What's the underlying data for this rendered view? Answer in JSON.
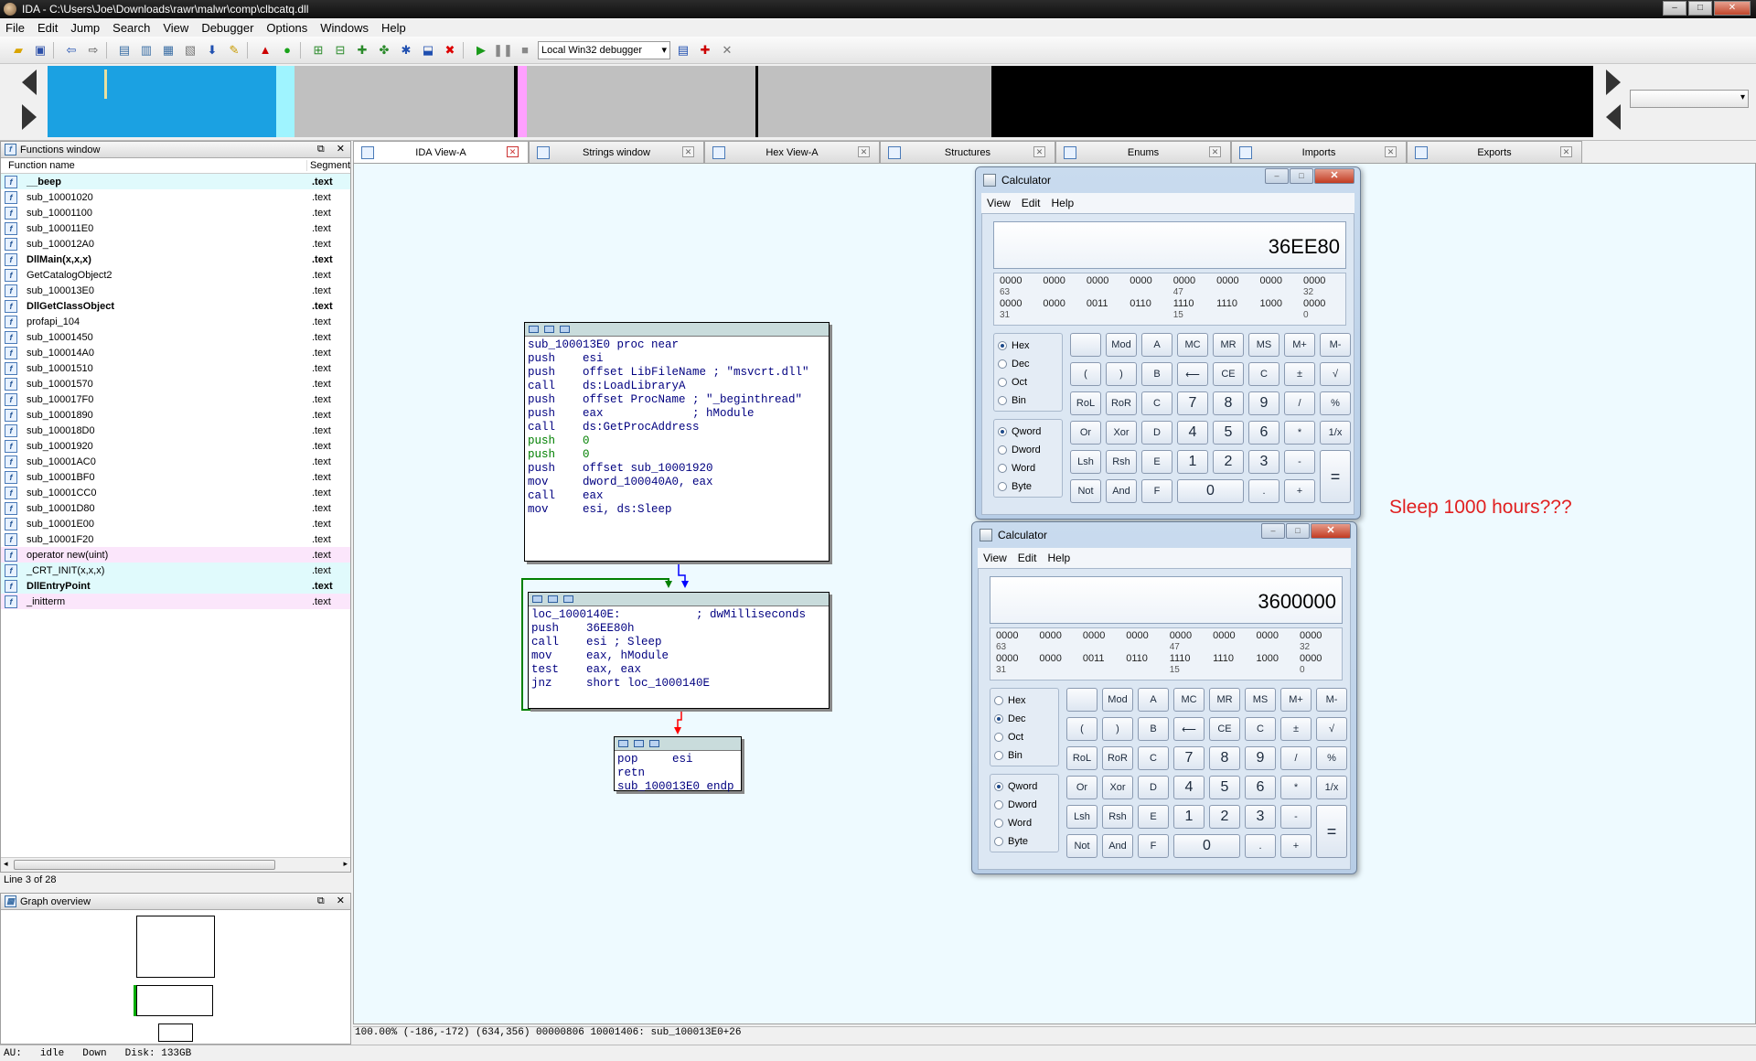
{
  "window": {
    "title": "IDA - C:\\Users\\Joe\\Downloads\\rawr\\malwr\\comp\\clbcatq.dll"
  },
  "menu": [
    "File",
    "Edit",
    "Jump",
    "Search",
    "View",
    "Debugger",
    "Options",
    "Windows",
    "Help"
  ],
  "toolbar": {
    "debugger_select": "Local Win32 debugger"
  },
  "functions_window": {
    "title": "Functions window",
    "col_name": "Function name",
    "col_segment": "Segment",
    "rows": [
      {
        "name": "__beep",
        "seg": ".text",
        "style": "bold cyan"
      },
      {
        "name": "sub_10001020",
        "seg": ".text",
        "style": ""
      },
      {
        "name": "sub_10001100",
        "seg": ".text",
        "style": ""
      },
      {
        "name": "sub_100011E0",
        "seg": ".text",
        "style": ""
      },
      {
        "name": "sub_100012A0",
        "seg": ".text",
        "style": ""
      },
      {
        "name": "DllMain(x,x,x)",
        "seg": ".text",
        "style": "bold"
      },
      {
        "name": "GetCatalogObject2",
        "seg": ".text",
        "style": ""
      },
      {
        "name": "sub_100013E0",
        "seg": ".text",
        "style": ""
      },
      {
        "name": "DllGetClassObject",
        "seg": ".text",
        "style": "bold"
      },
      {
        "name": "profapi_104",
        "seg": ".text",
        "style": ""
      },
      {
        "name": "sub_10001450",
        "seg": ".text",
        "style": ""
      },
      {
        "name": "sub_100014A0",
        "seg": ".text",
        "style": ""
      },
      {
        "name": "sub_10001510",
        "seg": ".text",
        "style": ""
      },
      {
        "name": "sub_10001570",
        "seg": ".text",
        "style": ""
      },
      {
        "name": "sub_100017F0",
        "seg": ".text",
        "style": ""
      },
      {
        "name": "sub_10001890",
        "seg": ".text",
        "style": ""
      },
      {
        "name": "sub_100018D0",
        "seg": ".text",
        "style": ""
      },
      {
        "name": "sub_10001920",
        "seg": ".text",
        "style": ""
      },
      {
        "name": "sub_10001AC0",
        "seg": ".text",
        "style": ""
      },
      {
        "name": "sub_10001BF0",
        "seg": ".text",
        "style": ""
      },
      {
        "name": "sub_10001CC0",
        "seg": ".text",
        "style": ""
      },
      {
        "name": "sub_10001D80",
        "seg": ".text",
        "style": ""
      },
      {
        "name": "sub_10001E00",
        "seg": ".text",
        "style": ""
      },
      {
        "name": "sub_10001F20",
        "seg": ".text",
        "style": ""
      },
      {
        "name": "operator new(uint)",
        "seg": ".text",
        "style": "pink"
      },
      {
        "name": "_CRT_INIT(x,x,x)",
        "seg": ".text",
        "style": "cyan"
      },
      {
        "name": "DllEntryPoint",
        "seg": ".text",
        "style": "bold cyan"
      },
      {
        "name": "_initterm",
        "seg": ".text",
        "style": "pink"
      }
    ],
    "line_status": "Line 3 of 28"
  },
  "graph_overview": {
    "title": "Graph overview"
  },
  "tabs": [
    "IDA View-A",
    "Strings window",
    "Hex View-A",
    "Structures",
    "Enums",
    "Imports",
    "Exports"
  ],
  "graph": {
    "node1": [
      "",
      "",
      "sub_100013E0 proc near",
      "push    esi",
      "push    offset LibFileName ; \"msvcrt.dll\"",
      "call    ds:LoadLibraryA",
      "push    offset ProcName ; \"_beginthread\"",
      "push    eax             ; hModule",
      "call    ds:GetProcAddress",
      "push    0",
      "push    0",
      "push    offset sub_10001920",
      "mov     dword_100040A0, eax",
      "call    eax",
      "mov     esi, ds:Sleep"
    ],
    "node2": [
      "",
      "loc_1000140E:           ; dwMilliseconds",
      "push    36EE80h",
      "call    esi ; Sleep",
      "mov     eax, hModule",
      "test    eax, eax",
      "jnz     short loc_1000140E"
    ],
    "node3": [
      "pop     esi",
      "retn",
      "sub_100013E0 endp"
    ],
    "status": "100.00% (-186,-172) (634,356) 00000806 10001406: sub_100013E0+26"
  },
  "bottom_status": {
    "au": "AU:",
    "state": "idle",
    "direction": "Down",
    "disk": "Disk: 133GB"
  },
  "calc_top": {
    "title": "Calculator",
    "menu": [
      "View",
      "Edit",
      "Help"
    ],
    "display": "36EE80",
    "bits_row1": [
      "0000",
      "0000",
      "0000",
      "0000",
      "0000",
      "0000",
      "0000",
      "0000"
    ],
    "bits_idx1": [
      "63",
      "",
      "",
      "",
      "47",
      "",
      "",
      "32"
    ],
    "bits_row2": [
      "0000",
      "0000",
      "0011",
      "0110",
      "1110",
      "1110",
      "1000",
      "0000"
    ],
    "bits_idx2": [
      "31",
      "",
      "",
      "",
      "15",
      "",
      "",
      "0"
    ],
    "radix": [
      "Hex",
      "Dec",
      "Oct",
      "Bin"
    ],
    "radix_selected": "Hex",
    "word": [
      "Qword",
      "Dword",
      "Word",
      "Byte"
    ],
    "word_selected": "Qword"
  },
  "calc_bottom": {
    "title": "Calculator",
    "menu": [
      "View",
      "Edit",
      "Help"
    ],
    "display": "3600000",
    "bits_row1": [
      "0000",
      "0000",
      "0000",
      "0000",
      "0000",
      "0000",
      "0000",
      "0000"
    ],
    "bits_idx1": [
      "63",
      "",
      "",
      "",
      "47",
      "",
      "",
      "32"
    ],
    "bits_row2": [
      "0000",
      "0000",
      "0011",
      "0110",
      "1110",
      "1110",
      "1000",
      "0000"
    ],
    "bits_idx2": [
      "31",
      "",
      "",
      "",
      "15",
      "",
      "",
      "0"
    ],
    "radix": [
      "Hex",
      "Dec",
      "Oct",
      "Bin"
    ],
    "radix_selected": "Dec",
    "word": [
      "Qword",
      "Dword",
      "Word",
      "Byte"
    ],
    "word_selected": "Qword"
  },
  "calc_keys": [
    [
      "",
      "Mod",
      "A",
      "MC",
      "MR",
      "MS",
      "M+",
      "M-"
    ],
    [
      "(",
      ")",
      "B",
      "⟵",
      "CE",
      "C",
      "±",
      "√"
    ],
    [
      "RoL",
      "RoR",
      "C",
      "7",
      "8",
      "9",
      "/",
      "%"
    ],
    [
      "Or",
      "Xor",
      "D",
      "4",
      "5",
      "6",
      "*",
      "1/x"
    ],
    [
      "Lsh",
      "Rsh",
      "E",
      "1",
      "2",
      "3",
      "-",
      ""
    ],
    [
      "Not",
      "And",
      "F",
      "0",
      "",
      ".",
      "+",
      ""
    ]
  ],
  "calc_equals": "=",
  "annotation": "Sleep 1000 hours???",
  "colors": {
    "nav_blue": "#1ba1e2",
    "nav_cyan": "#9ff4ff",
    "nav_gray": "#c0c0c0",
    "nav_black": "#000000",
    "annotation_red": "#e02020"
  }
}
